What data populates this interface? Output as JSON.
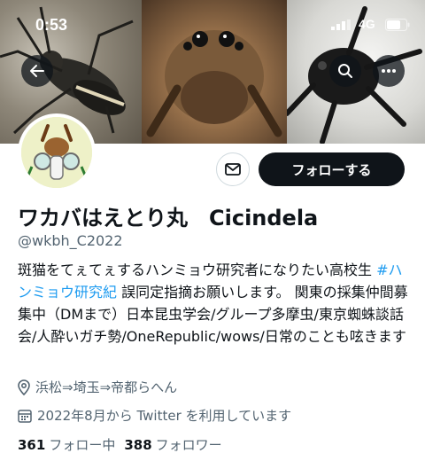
{
  "status_bar": {
    "time": "0:53",
    "network": "4G"
  },
  "profile": {
    "name": "ワカバはえとり丸　Cicindela",
    "handle": "@wkbh_C2022",
    "follow_label": "フォローする",
    "bio_part1": "斑猫をてぇてぇするハンミョウ研究者になりたい高校生 ",
    "bio_hashtag": "#ハンミョウ研究紀",
    "bio_part2": " 誤同定指摘お願いします。 関東の採集仲間募集中（DMまで）日本昆虫学会/グループ多摩虫/東京蜘蛛談話会/人酔いガチ勢/OneRepublic/wows/日常のことも呟きます",
    "location": "浜松⇒埼玉⇒帝都らへん",
    "joined": "2022年8月から Twitter を利用しています",
    "following_count": "361",
    "following_label": "フォロー中",
    "followers_count": "388",
    "followers_label": "フォロワー"
  },
  "icons": {
    "back": "arrow-left-icon",
    "search": "search-icon",
    "more": "more-icon",
    "message": "envelope-icon",
    "location": "location-pin-icon",
    "calendar": "calendar-icon"
  },
  "colors": {
    "accent": "#1d9bf0",
    "follow_bg": "#0f1419",
    "secondary_text": "#536471"
  }
}
